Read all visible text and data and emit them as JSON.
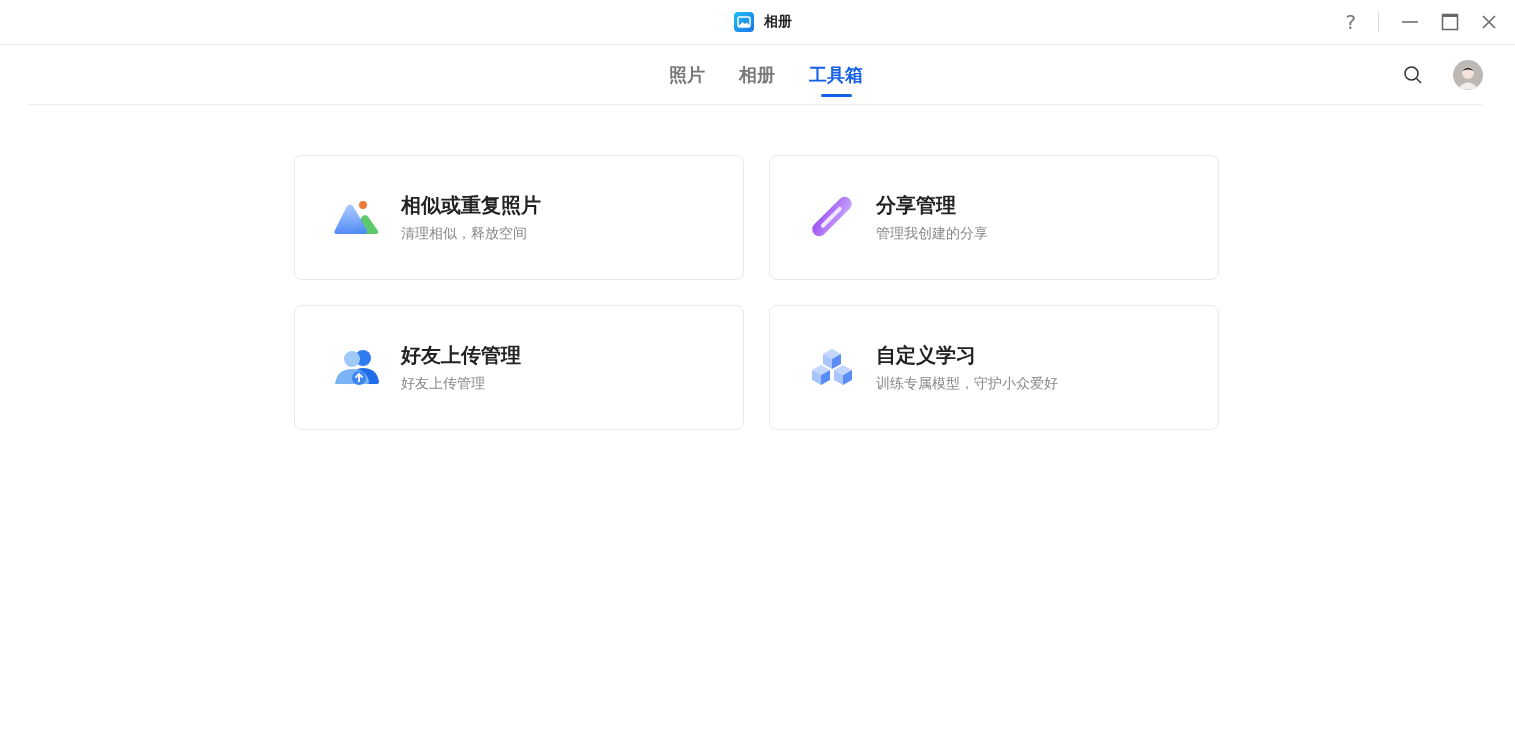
{
  "window": {
    "title": "相册",
    "help_label": "?"
  },
  "tabs": [
    {
      "label": "照片",
      "selected": false
    },
    {
      "label": "相册",
      "selected": false
    },
    {
      "label": "工具箱",
      "selected": true
    }
  ],
  "tools": [
    {
      "kind": "photos",
      "title": "相似或重复照片",
      "subtitle": "清理相似，释放空间"
    },
    {
      "kind": "link",
      "title": "分享管理",
      "subtitle": "管理我创建的分享"
    },
    {
      "kind": "friends",
      "title": "好友上传管理",
      "subtitle": "好友上传管理"
    },
    {
      "kind": "cubes",
      "title": "自定义学习",
      "subtitle": "训练专属模型，守护小众爱好"
    }
  ]
}
